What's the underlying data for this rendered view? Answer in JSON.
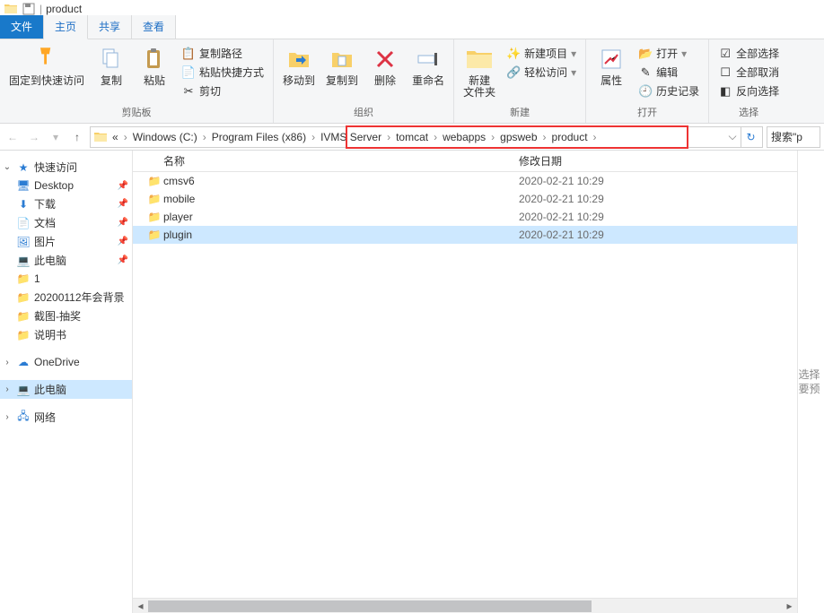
{
  "window": {
    "title": "product"
  },
  "tabs": {
    "file": "文件",
    "home": "主页",
    "share": "共享",
    "view": "查看"
  },
  "ribbon": {
    "clipboard": {
      "pin": "固定到快速访问",
      "copy": "复制",
      "paste": "粘贴",
      "copypath": "复制路径",
      "pasteshortcut": "粘贴快捷方式",
      "cut": "剪切",
      "label": "剪贴板"
    },
    "organize": {
      "moveto": "移动到",
      "copyto": "复制到",
      "delete": "删除",
      "rename": "重命名",
      "label": "组织"
    },
    "new": {
      "newfolder": "新建\n文件夹",
      "newitem": "新建项目",
      "easyaccess": "轻松访问",
      "label": "新建"
    },
    "open": {
      "properties": "属性",
      "open": "打开",
      "edit": "编辑",
      "history": "历史记录",
      "label": "打开"
    },
    "select": {
      "selectall": "全部选择",
      "selectnone": "全部取消",
      "invert": "反向选择",
      "label": "选择"
    }
  },
  "breadcrumbs": [
    "«",
    "Windows (C:)",
    "Program Files (x86)",
    "IVMS Server",
    "tomcat",
    "webapps",
    "gpsweb",
    "product"
  ],
  "search_placeholder": "搜索\"p",
  "sidebar": {
    "quick": "快速访问",
    "items": [
      {
        "label": "Desktop",
        "icon": "desktop"
      },
      {
        "label": "下载",
        "icon": "downloads"
      },
      {
        "label": "文档",
        "icon": "documents"
      },
      {
        "label": "图片",
        "icon": "pictures"
      },
      {
        "label": "此电脑",
        "icon": "pc"
      },
      {
        "label": "1",
        "icon": "folder"
      },
      {
        "label": "20200112年会背景",
        "icon": "folder"
      },
      {
        "label": "截图-抽奖",
        "icon": "folder"
      },
      {
        "label": "说明书",
        "icon": "folder"
      }
    ],
    "onedrive": "OneDrive",
    "thispc": "此电脑",
    "network": "网络"
  },
  "columns": {
    "name": "名称",
    "modified": "修改日期"
  },
  "files": [
    {
      "name": "cmsv6",
      "modified": "2020-02-21 10:29"
    },
    {
      "name": "mobile",
      "modified": "2020-02-21 10:29"
    },
    {
      "name": "player",
      "modified": "2020-02-21 10:29"
    },
    {
      "name": "plugin",
      "modified": "2020-02-21 10:29"
    }
  ],
  "preview_hint": "选择要预"
}
